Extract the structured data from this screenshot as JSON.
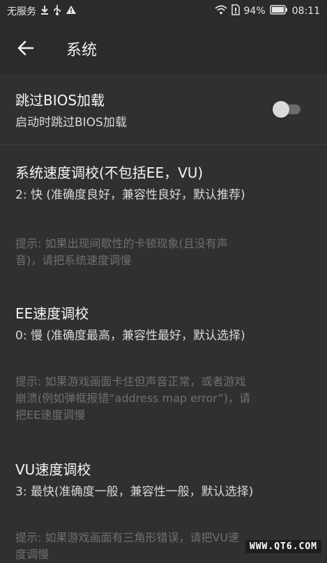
{
  "status_bar": {
    "carrier": "无服务",
    "battery_percent": "94%",
    "time": "08:11",
    "icons_left": [
      "download-icon",
      "usb-icon",
      "warning-icon"
    ],
    "icons_right": [
      "wifi-icon",
      "sim-icon",
      "battery-icon"
    ]
  },
  "app_bar": {
    "title": "系统",
    "back_icon": "arrow-left-icon"
  },
  "settings": {
    "skip_bios": {
      "title": "跳过BIOS加载",
      "summary": "启动时跳过BIOS加载",
      "enabled": false
    },
    "system_speed": {
      "title": "系统速度调校(不包括EE，VU)",
      "summary": "2: 快 (准确度良好，兼容性良好，默认推荐)",
      "hint_line1": "提示: 如果出现间歇性的卡顿现象(且没有声",
      "hint_line2": "音)，请把系统速度调慢"
    },
    "ee_speed": {
      "title": "EE速度调校",
      "summary": "0: 慢 (准确度最高，兼容性最好，默认选择)",
      "hint_line1": "提示: 如果游戏画面卡住但声音正常，或者游戏",
      "hint_line2": "崩溃(例如弹框报错“address map error”)，请",
      "hint_line3": "把EE速度调慢"
    },
    "vu_speed": {
      "title": "VU速度调校",
      "summary": "3: 最快(准确度一般，兼容性一般，默认选择)",
      "hint_line1": "提示: 如果游戏画面有三角形错误，请把VU速",
      "hint_line2": "度调慢"
    }
  },
  "watermark": "WWW.QT6.COM"
}
